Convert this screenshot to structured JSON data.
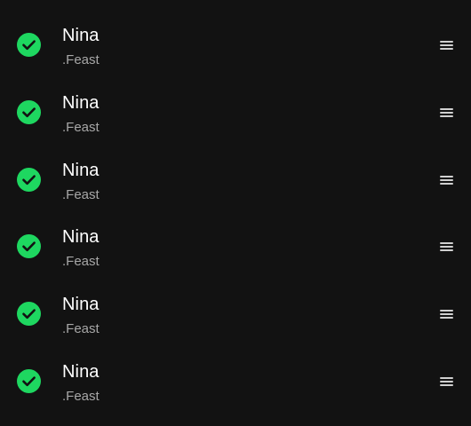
{
  "colors": {
    "background": "#121212",
    "accent_green": "#1ed760",
    "title_text": "#ffffff",
    "subtitle_text": "#a7a7a7",
    "handle": "#d0d0d0"
  },
  "tracks": [
    {
      "title": "Nina",
      "artist": ".Feast",
      "downloaded_icon": "check-circle-icon",
      "handle_icon": "drag-handle-icon"
    },
    {
      "title": "Nina",
      "artist": ".Feast",
      "downloaded_icon": "check-circle-icon",
      "handle_icon": "drag-handle-icon"
    },
    {
      "title": "Nina",
      "artist": ".Feast",
      "downloaded_icon": "check-circle-icon",
      "handle_icon": "drag-handle-icon"
    },
    {
      "title": "Nina",
      "artist": ".Feast",
      "downloaded_icon": "check-circle-icon",
      "handle_icon": "drag-handle-icon"
    },
    {
      "title": "Nina",
      "artist": ".Feast",
      "downloaded_icon": "check-circle-icon",
      "handle_icon": "drag-handle-icon"
    },
    {
      "title": "Nina",
      "artist": ".Feast",
      "downloaded_icon": "check-circle-icon",
      "handle_icon": "drag-handle-icon"
    }
  ]
}
